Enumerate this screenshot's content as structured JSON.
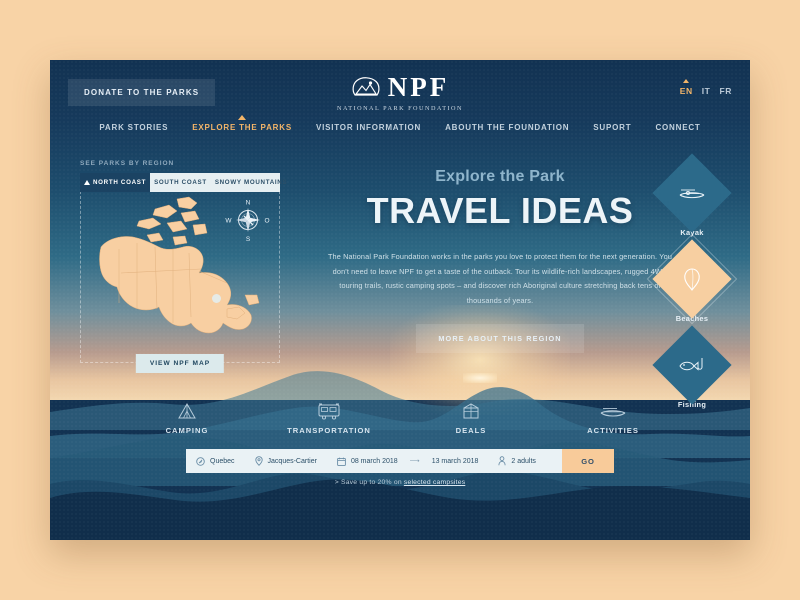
{
  "theme": {
    "page_bg": "#F8D3A6",
    "card_bg": "#123252",
    "accent_orange": "#F3B569",
    "accent_peach": "#F7CFA1",
    "panel_light": "#E6EFF2"
  },
  "header": {
    "donate_label": "DONATE TO THE PARKS",
    "logo": {
      "word": "NPF",
      "subtitle": "NATIONAL PARK FOUNDATION",
      "icon": "mountain-circle-icon"
    },
    "languages": [
      {
        "code": "EN",
        "active": true
      },
      {
        "code": "IT",
        "active": false
      },
      {
        "code": "FR",
        "active": false
      }
    ]
  },
  "nav": {
    "items": [
      {
        "label": "PARK STORIES",
        "active": false
      },
      {
        "label": "EXPLORE THE PARKS",
        "active": true
      },
      {
        "label": "VISITOR INFORMATION",
        "active": false
      },
      {
        "label": "ABOUTH THE FOUNDATION",
        "active": false
      },
      {
        "label": "SUPORT",
        "active": false
      },
      {
        "label": "CONNECT",
        "active": false
      }
    ]
  },
  "map_panel": {
    "label": "SEE PARKS BY REGION",
    "tabs": [
      {
        "label": "NORTH COAST",
        "active": true
      },
      {
        "label": "SOUTH COAST",
        "active": false
      },
      {
        "label": "SNOWY MOUNTAINS",
        "active": false
      }
    ],
    "compass": {
      "north": "N",
      "west": "W",
      "east": "O",
      "south": "S"
    },
    "view_map_label": "VIEW NPF MAP",
    "map_region": "Canada"
  },
  "hero": {
    "eyebrow": "Explore the Park",
    "title": "TRAVEL IDEAS",
    "body": "The National Park Foundation works in the parks you love to protect them for the next generation. You don't need to leave NPF to get a taste of the outback. Tour its wildlife-rich landscapes, rugged 4WD touring trails, rustic camping spots – and discover rich Aboriginal culture stretching back tens of thousands of years.",
    "cta_label": "MORE ABOUT THIS REGION"
  },
  "badges": [
    {
      "label": "Kayak",
      "icon": "kayak-icon",
      "highlighted": false
    },
    {
      "label": "Beaches",
      "icon": "balloon-icon",
      "highlighted": true
    },
    {
      "label": "Fishing",
      "icon": "fish-hook-icon",
      "highlighted": false
    }
  ],
  "categories": [
    {
      "label": "CAMPING",
      "icon": "tent-icon"
    },
    {
      "label": "TRANSPORTATION",
      "icon": "bus-icon"
    },
    {
      "label": "DEALS",
      "icon": "gift-tag-icon"
    },
    {
      "label": "ACTIVITIES",
      "icon": "canoe-icon"
    }
  ],
  "booking": {
    "region": {
      "value": "Quebec",
      "icon": "compass-icon"
    },
    "park": {
      "value": "Jacques-Cartier",
      "icon": "map-pin-icon"
    },
    "date_from": {
      "value": "08 march 2018",
      "icon": "calendar-icon"
    },
    "date_arrow": "⟶",
    "date_to": {
      "value": "13 march 2018"
    },
    "guests": {
      "value": "2 adults",
      "icon": "person-icon"
    },
    "submit_label": "GO"
  },
  "promo": {
    "prefix": "> Save up to 20% on ",
    "link_label": "selected campsites"
  }
}
